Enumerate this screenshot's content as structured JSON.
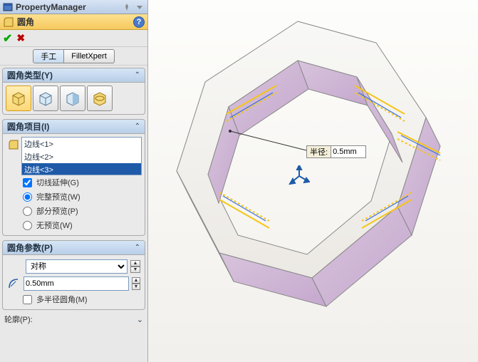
{
  "pm": {
    "title": "PropertyManager"
  },
  "feature": {
    "title": "圆角"
  },
  "tabs": {
    "manual": "手工",
    "filletxpert": "FilletXpert"
  },
  "sections": {
    "type": {
      "title": "圆角类型(Y)"
    },
    "items": {
      "title": "圆角项目(I)",
      "list": [
        "边线<1>",
        "边线<2>",
        "边线<3>"
      ],
      "tangent": "切线延伸(G)",
      "full": "完整预览(W)",
      "partial": "部分预览(P)",
      "none": "无预览(W)"
    },
    "params": {
      "title": "圆角参数(P)",
      "symmetric": "对称",
      "radius": "0.50mm",
      "multi": "多半径圆角(M)"
    }
  },
  "profile": "轮廓(P):",
  "callout": {
    "label": "半径:",
    "value": "0.5mm"
  }
}
